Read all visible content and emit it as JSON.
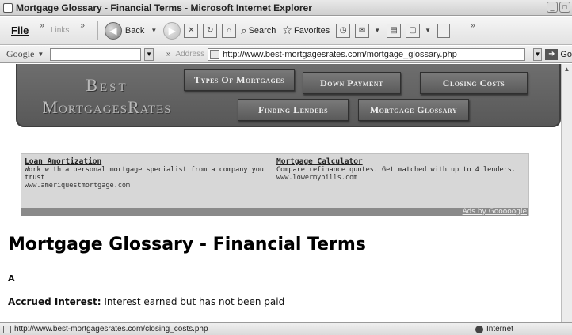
{
  "window": {
    "title": "Mortgage Glossary - Financial Terms - Microsoft Internet Explorer"
  },
  "menu": {
    "file": "File",
    "links": "Links"
  },
  "toolbar": {
    "back": "Back",
    "search": "Search",
    "favorites": "Favorites"
  },
  "google_bar": {
    "label": "Google",
    "search_value": ""
  },
  "address_bar": {
    "label": "Address",
    "url": "http://www.best-mortgagesrates.com/mortgage_glossary.php",
    "go": "Go"
  },
  "site": {
    "logo_line1": "Best",
    "logo_line2": "MortgagesRates",
    "nav": {
      "types": "Types Of Mortgages",
      "down_payment": "Down Payment",
      "closing_costs": "Closing Costs",
      "finding_lenders": "Finding Lenders",
      "glossary": "Mortgage Glossary"
    }
  },
  "ads": [
    {
      "title": "Loan Amortization",
      "text": "Work with a personal mortgage specialist from a company you trust",
      "url": "www.ameriquestmortgage.com"
    },
    {
      "title": "Mortgage Calculator",
      "text": "Compare refinance quotes. Get matched with up to 4 lenders.",
      "url": "www.lowermybills.com"
    }
  ],
  "ads_by": "Ads by Gooooogle",
  "page": {
    "heading": "Mortgage Glossary - Financial Terms",
    "letter": "A",
    "terms": [
      {
        "term": "Accrued Interest:",
        "definition": " Interest earned but has not been paid"
      }
    ]
  },
  "status": {
    "url": "http://www.best-mortgagesrates.com/closing_costs.php",
    "zone": "Internet"
  }
}
